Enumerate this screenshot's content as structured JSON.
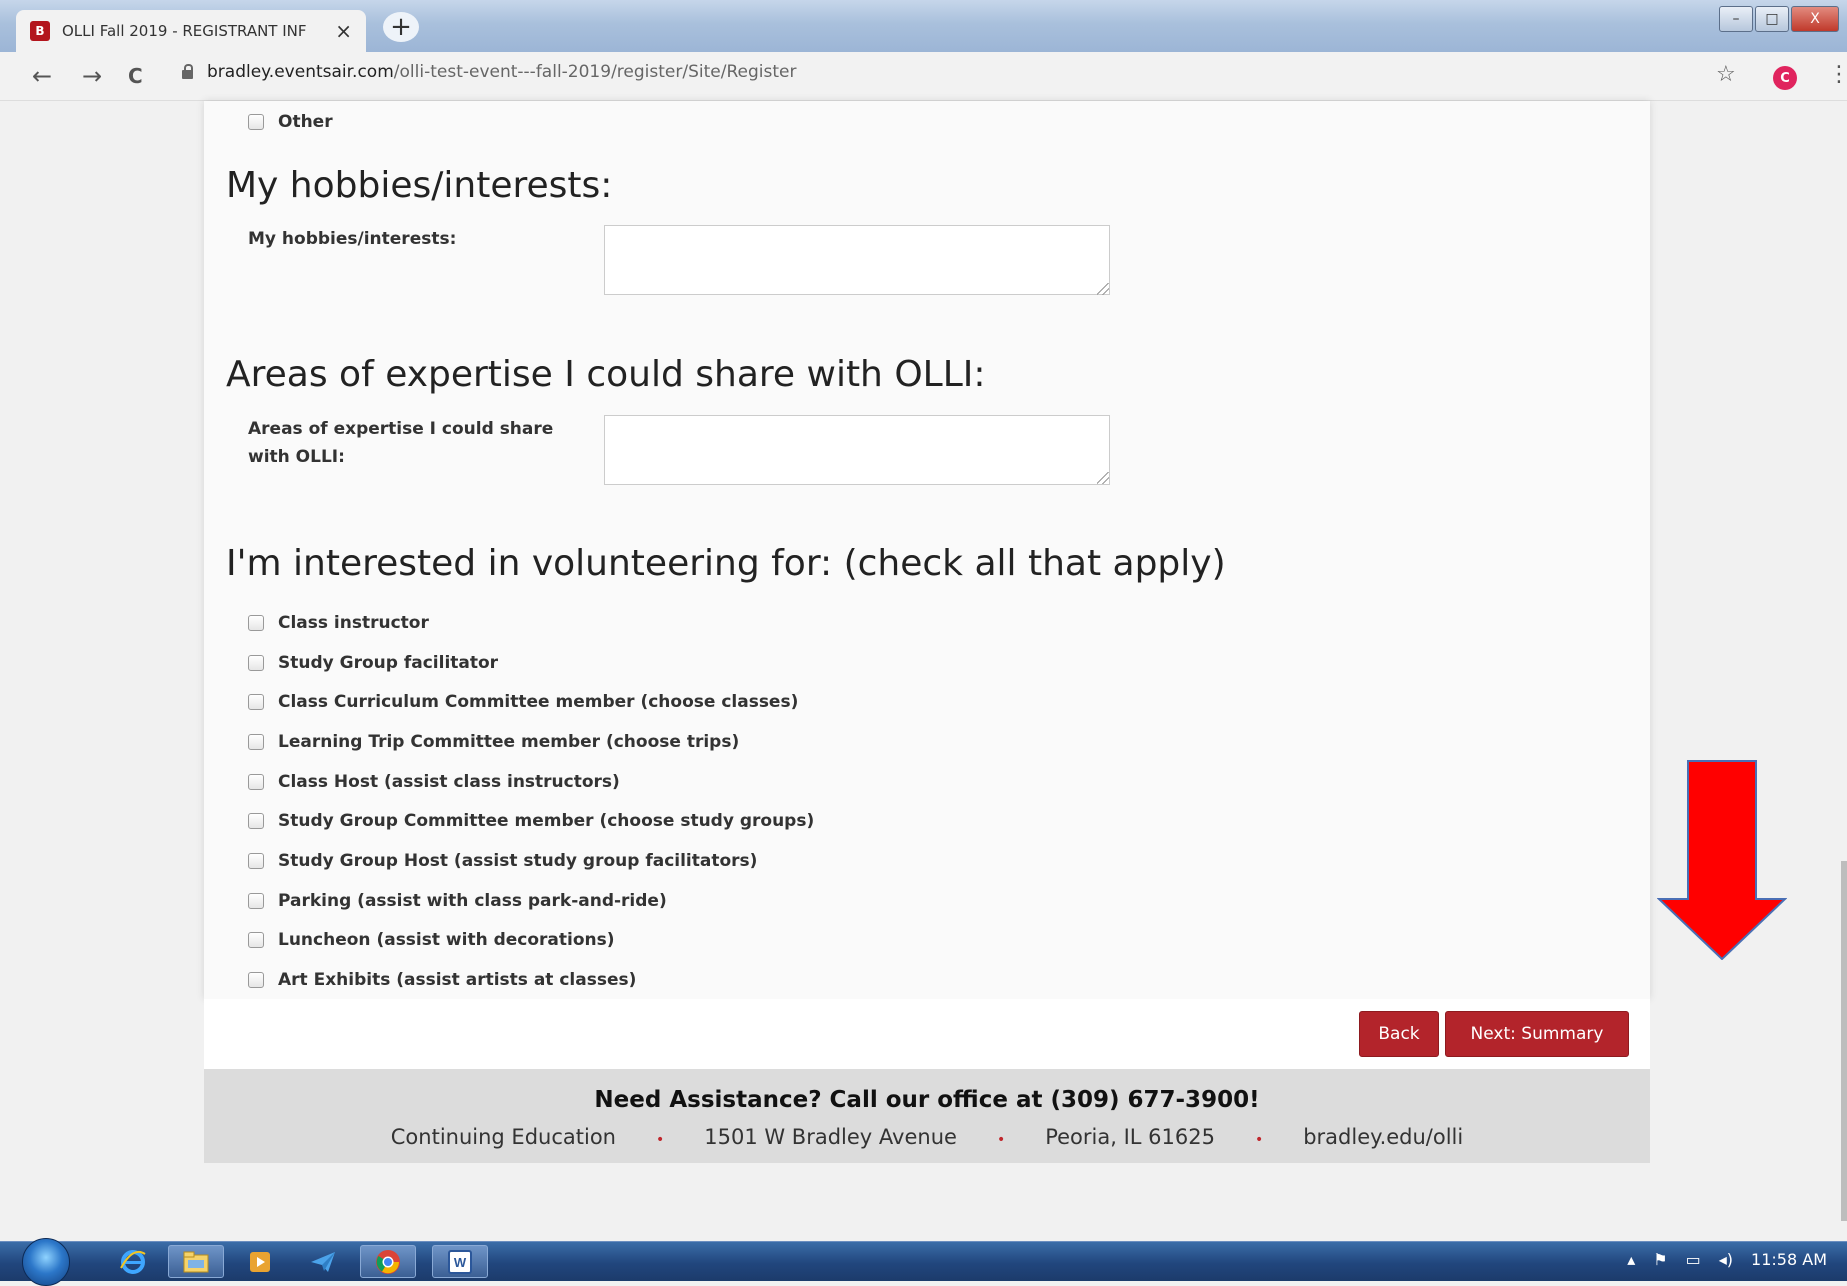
{
  "browser": {
    "tab_title": "OLLI Fall 2019 - REGISTRANT INF",
    "tab_close": "×",
    "new_tab": "+",
    "favicon_letter": "B",
    "url_domain": "bradley.eventsair.com",
    "url_path": "/olli-test-event---fall-2019/register/Site/Register",
    "profile_initial": "C",
    "back_glyph": "←",
    "forward_glyph": "→",
    "reload_glyph": "C",
    "star_glyph": "☆",
    "menu_glyph": "⋮",
    "min_glyph": "–",
    "max_glyph": "□",
    "close_glyph": "X"
  },
  "form": {
    "other_label": "Other",
    "hobbies": {
      "heading": "My hobbies/interests:",
      "label": "My hobbies/interests:",
      "value": ""
    },
    "expertise": {
      "heading": "Areas of expertise I could share with OLLI:",
      "label": "Areas of expertise I could share with OLLI:",
      "value": ""
    },
    "volunteer": {
      "heading": "I'm interested in volunteering for: (check all that apply)",
      "options": [
        "Class instructor",
        "Study Group facilitator",
        "Class Curriculum Committee member (choose classes)",
        "Learning Trip Committee member (choose trips)",
        "Class Host (assist class instructors)",
        "Study Group Committee member (choose study groups)",
        "Study Group Host (assist study group facilitators)",
        "Parking (assist with class park-and-ride)",
        "Luncheon (assist with decorations)",
        "Art Exhibits (assist artists at classes)"
      ]
    },
    "back_button": "Back",
    "next_button": "Next: Summary"
  },
  "footer": {
    "assist": "Need Assistance?  Call our office at (309) 677-3900!",
    "items": [
      "Continuing Education",
      "1501 W Bradley Avenue",
      "Peoria, IL 61625",
      "bradley.edu/olli"
    ],
    "separator": "•"
  },
  "taskbar": {
    "clock": "11:58 AM"
  },
  "colors": {
    "brand_red": "#b3242b",
    "annotation_arrow": "#ff0000"
  }
}
